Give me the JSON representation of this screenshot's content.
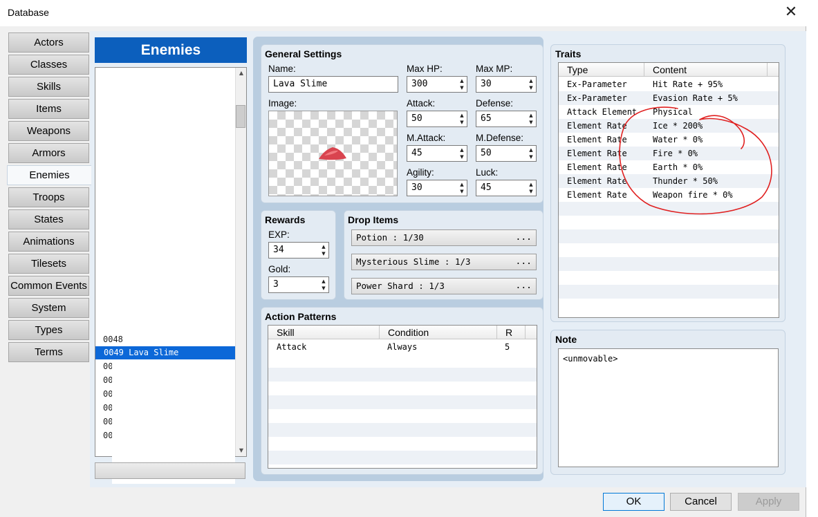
{
  "window": {
    "title": "Database"
  },
  "nav": {
    "items": [
      "Actors",
      "Classes",
      "Skills",
      "Items",
      "Weapons",
      "Armors",
      "Enemies",
      "Troops",
      "States",
      "Animations",
      "Tilesets",
      "Common Events",
      "System",
      "Types",
      "Terms"
    ],
    "active": "Enemies"
  },
  "list": {
    "header": "Enemies",
    "items": [
      "0048",
      "0049 Lava Slime",
      "00",
      "00",
      "00",
      "00",
      "00",
      "00"
    ],
    "selected": "0049 Lava Slime"
  },
  "general": {
    "title": "General Settings",
    "name_label": "Name:",
    "name": "Lava Slime",
    "image_label": "Image:",
    "maxhp_label": "Max HP:",
    "maxhp": "300",
    "maxmp_label": "Max MP:",
    "maxmp": "30",
    "attack_label": "Attack:",
    "attack": "50",
    "defense_label": "Defense:",
    "defense": "65",
    "mattack_label": "M.Attack:",
    "mattack": "45",
    "mdefense_label": "M.Defense:",
    "mdefense": "50",
    "agility_label": "Agility:",
    "agility": "30",
    "luck_label": "Luck:",
    "luck": "45"
  },
  "rewards": {
    "title": "Rewards",
    "exp_label": "EXP:",
    "exp": "34",
    "gold_label": "Gold:",
    "gold": "3"
  },
  "drops": {
    "title": "Drop Items",
    "items": [
      "Potion : 1/30",
      "Mysterious Slime : 1/3",
      "Power Shard : 1/3"
    ],
    "more": "..."
  },
  "actions": {
    "title": "Action Patterns",
    "columns": [
      "Skill",
      "Condition",
      "R"
    ],
    "rows": [
      {
        "skill": "Attack",
        "condition": "Always",
        "r": "5"
      }
    ]
  },
  "traits": {
    "title": "Traits",
    "columns": [
      "Type",
      "Content"
    ],
    "rows": [
      {
        "type": "Ex-Parameter",
        "content": "Hit Rate + 95%"
      },
      {
        "type": "Ex-Parameter",
        "content": "Evasion Rate + 5%"
      },
      {
        "type": "Attack Element",
        "content": "Physical"
      },
      {
        "type": "Element Rate",
        "content": "Ice * 200%"
      },
      {
        "type": "Element Rate",
        "content": "Water * 0%"
      },
      {
        "type": "Element Rate",
        "content": "Fire * 0%"
      },
      {
        "type": "Element Rate",
        "content": "Earth * 0%"
      },
      {
        "type": "Element Rate",
        "content": "Thunder * 50%"
      },
      {
        "type": "Element Rate",
        "content": "Weapon fire * 0%"
      }
    ]
  },
  "note": {
    "title": "Note",
    "text": "<unmovable>"
  },
  "buttons": {
    "ok": "OK",
    "cancel": "Cancel",
    "apply": "Apply"
  },
  "colors": {
    "accent": "#0c5fbd",
    "selection": "#0c68d8",
    "annotation": "#e02020"
  },
  "icons": {
    "close": "close-icon",
    "spin": "spinner-arrows-icon",
    "scroll_up": "scroll-up-arrow-icon",
    "scroll_down": "scroll-down-arrow-icon"
  }
}
